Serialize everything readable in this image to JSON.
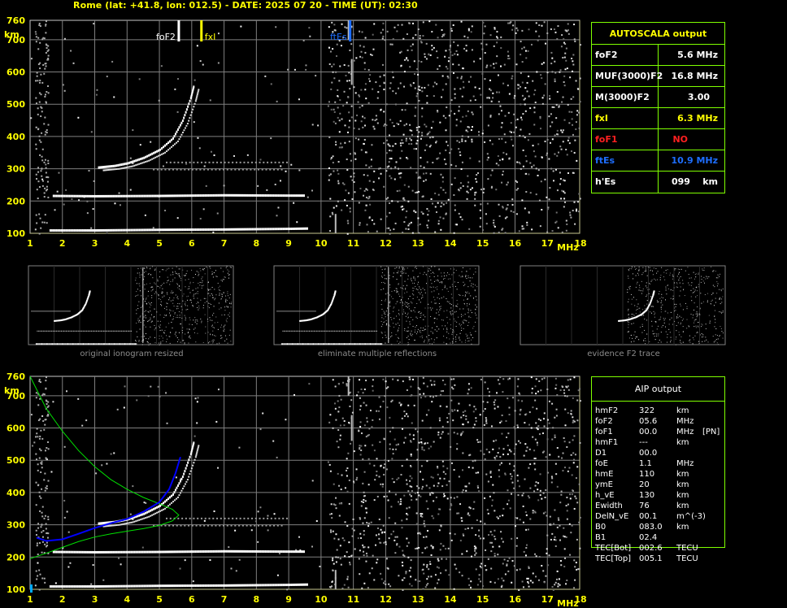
{
  "header": "Rome (lat: +41.8, lon: 012.5) - DATE: 2025 07 20 - TIME (UT): 02:30",
  "chart_data": [
    {
      "type": "scatter",
      "xlabel": "MHz",
      "ylabel": "km",
      "xlim": [
        1,
        18
      ],
      "ylim": [
        100,
        760
      ],
      "x_ticks": [
        "1",
        "2",
        "3",
        "4",
        "5",
        "6",
        "7",
        "8",
        "9",
        "10",
        "11",
        "12",
        "13",
        "14",
        "15",
        "16",
        "17",
        "18"
      ],
      "y_ticks": [
        "100",
        "200",
        "300",
        "400",
        "500",
        "600",
        "700",
        "760"
      ],
      "markers": [
        {
          "name": "foF2",
          "freq": 5.6,
          "color": "#ffffff"
        },
        {
          "name": "fxI",
          "freq": 6.3,
          "color": "#ffff00"
        },
        {
          "name": "ftEs",
          "freq": 10.9,
          "color": "#1e6eff"
        }
      ],
      "traces": [
        {
          "name": "E",
          "points": [
            [
              1.6,
              110
            ],
            [
              3,
              110
            ],
            [
              5,
              112
            ],
            [
              7,
              113
            ],
            [
              9,
              115
            ],
            [
              9.6,
              116
            ]
          ]
        },
        {
          "name": "Es2",
          "points": [
            [
              1.7,
              217
            ],
            [
              3,
              216
            ],
            [
              5,
              217
            ],
            [
              7,
              219
            ],
            [
              9,
              218
            ],
            [
              9.5,
              218
            ]
          ]
        },
        {
          "name": "F2",
          "points": [
            [
              3.1,
              305
            ],
            [
              3.6,
              310
            ],
            [
              4,
              318
            ],
            [
              4.5,
              335
            ],
            [
              5,
              360
            ],
            [
              5.4,
              395
            ],
            [
              5.7,
              450
            ],
            [
              5.95,
              520
            ],
            [
              6.05,
              560
            ]
          ]
        }
      ]
    },
    {
      "type": "scatter",
      "xlabel": "MHz",
      "ylabel": "km",
      "xlim": [
        1,
        18
      ],
      "ylim": [
        100,
        760
      ],
      "x_ticks": [
        "1",
        "2",
        "3",
        "4",
        "5",
        "6",
        "7",
        "8",
        "9",
        "10",
        "11",
        "12",
        "13",
        "14",
        "15",
        "16",
        "17",
        "18"
      ],
      "y_ticks": [
        "100",
        "200",
        "300",
        "400",
        "500",
        "600",
        "700",
        "760"
      ],
      "profile_green": [
        [
          1,
          760
        ],
        [
          1.5,
          660
        ],
        [
          2,
          590
        ],
        [
          2.5,
          530
        ],
        [
          3,
          480
        ],
        [
          3.5,
          440
        ],
        [
          4,
          410
        ],
        [
          4.5,
          385
        ],
        [
          5,
          365
        ],
        [
          5.4,
          348
        ],
        [
          5.6,
          330
        ],
        [
          5.4,
          312
        ],
        [
          5,
          298
        ],
        [
          4.5,
          288
        ],
        [
          4,
          280
        ],
        [
          3.5,
          272
        ],
        [
          3,
          262
        ],
        [
          2.5,
          248
        ],
        [
          2,
          230
        ],
        [
          1.5,
          212
        ],
        [
          1,
          195
        ]
      ],
      "trace_blue": [
        [
          1.2,
          260
        ],
        [
          1.5,
          250
        ],
        [
          2,
          255
        ],
        [
          2.5,
          272
        ],
        [
          3,
          290
        ],
        [
          3.5,
          305
        ],
        [
          4,
          318
        ],
        [
          4.5,
          340
        ],
        [
          5,
          370
        ],
        [
          5.3,
          410
        ],
        [
          5.5,
          460
        ],
        [
          5.65,
          510
        ]
      ]
    }
  ],
  "autoscala": {
    "title": "AUTOSCALA output",
    "rows": [
      {
        "label": "foF2",
        "value": "5.6 MHz",
        "color": "#ffffff"
      },
      {
        "label": "MUF(3000)F2",
        "value": "16.8 MHz",
        "color": "#ffffff"
      },
      {
        "label": "M(3000)F2",
        "value": "3.00",
        "color": "#ffffff"
      },
      {
        "label": "fxI",
        "value": "6.3 MHz",
        "color": "#ffff00"
      },
      {
        "label": "foF1",
        "value": "NO",
        "color": "#ff2020"
      },
      {
        "label": "ftEs",
        "value": "10.9 MHz",
        "color": "#1e6eff"
      },
      {
        "label": "h'Es",
        "value": "099    km",
        "color": "#ffffff"
      }
    ]
  },
  "thumbnails": [
    {
      "caption": "original ionogram resized"
    },
    {
      "caption": "eliminate multiple reflections"
    },
    {
      "caption": "evidence F2 trace"
    }
  ],
  "aip": {
    "title": "AIP output",
    "rows": [
      [
        "hmF2",
        "322",
        "km",
        ""
      ],
      [
        "foF2",
        "05.6",
        "MHz",
        ""
      ],
      [
        "foF1",
        "00.0",
        "MHz",
        "[PN]"
      ],
      [
        "hmF1",
        "---",
        "km",
        ""
      ],
      [
        "D1",
        "00.0",
        "",
        ""
      ],
      [
        "foE",
        "1.1",
        "MHz",
        ""
      ],
      [
        "hmE",
        "110",
        "km",
        ""
      ],
      [
        "ymE",
        "20",
        "km",
        ""
      ],
      [
        "h_vE",
        "130",
        "km",
        ""
      ],
      [
        "Ewidth",
        "76",
        "km",
        ""
      ],
      [
        "DelN_vE",
        "00.1",
        "m^(-3)",
        ""
      ],
      [
        "B0",
        "083.0",
        "km",
        ""
      ],
      [
        "B1",
        "02.4",
        "",
        ""
      ],
      [
        "TEC[Bot]",
        "002.6",
        "TECU",
        ""
      ],
      [
        "TEC[Top]",
        "005.1",
        "TECU",
        ""
      ]
    ]
  },
  "colors": {
    "grid": "#7f7f7f",
    "frame": "#7fff00",
    "axis_text": "#ffff00",
    "trace": "#ffffff",
    "profile": "#00e000",
    "blue_trace": "#0000ff"
  }
}
